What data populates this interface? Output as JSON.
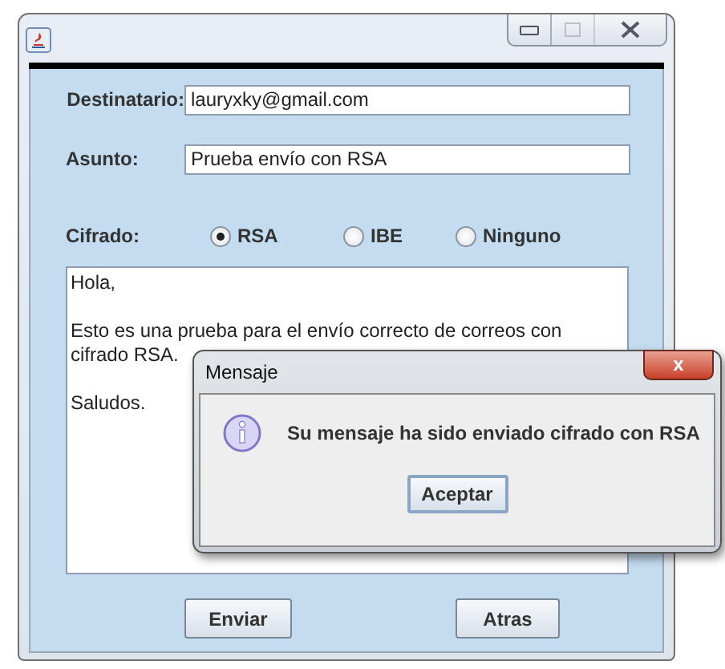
{
  "window": {
    "title_buttons": [
      {
        "kind": "minimize",
        "disabled": false
      },
      {
        "kind": "maximize",
        "disabled": true
      },
      {
        "kind": "close",
        "disabled": false
      }
    ]
  },
  "form": {
    "recipient": {
      "label": "Destinatario:",
      "value": "lauryxky@gmail.com"
    },
    "subject": {
      "label": "Asunto:",
      "value": "Prueba envío con RSA"
    },
    "encryption": {
      "label": "Cifrado:",
      "options": [
        {
          "label": "RSA",
          "selected": true
        },
        {
          "label": "IBE",
          "selected": false
        },
        {
          "label": "Ninguno",
          "selected": false
        }
      ]
    },
    "message": [
      [
        "Hola,"
      ],
      [
        "Esto es una prueba para el envío correcto de correos con",
        "cifrado RSA."
      ],
      [
        "Saludos."
      ]
    ],
    "buttons": [
      "Enviar",
      "Atras"
    ]
  },
  "dialog": {
    "title": "Mensaje",
    "close": "x",
    "text": "Su mensaje ha sido enviado cifrado con RSA",
    "button": "Aceptar"
  }
}
